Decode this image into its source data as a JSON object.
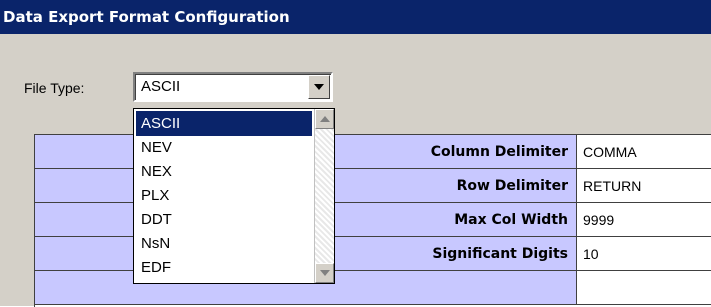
{
  "window": {
    "title": "Data Export Format Configuration"
  },
  "file_type": {
    "label": "File Type:",
    "value": "ASCII",
    "button_icon": "chevron-down-icon",
    "options": [
      "ASCII",
      "NEV",
      "NEX",
      "PLX",
      "DDT",
      "NsN",
      "EDF"
    ],
    "highlighted_option": "ASCII"
  },
  "settings": [
    {
      "label": "Column Delimiter",
      "value": "COMMA"
    },
    {
      "label": "Row Delimiter",
      "value": "RETURN"
    },
    {
      "label": "Max Col Width",
      "value": "9999"
    },
    {
      "label": "Significant Digits",
      "value": "10"
    }
  ],
  "colors": {
    "title_bg": "#0a246a",
    "grid_label_bg": "#c8c8ff",
    "panel_bg": "#d4d0c8",
    "selection_bg": "#0a246a"
  }
}
